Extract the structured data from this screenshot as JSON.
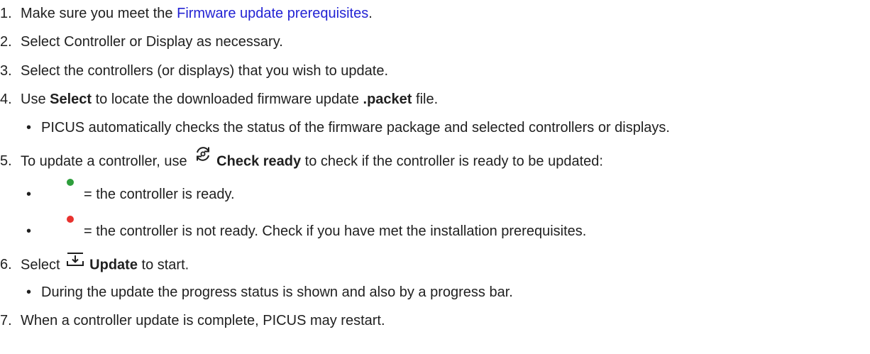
{
  "steps": [
    {
      "num": "1.",
      "pre": "Make sure you meet the ",
      "link": "Firmware update prerequisites",
      "post": "."
    },
    {
      "num": "2.",
      "text": "Select Controller or Display as necessary."
    },
    {
      "num": "3.",
      "text": "Select the controllers (or displays) that you wish to update."
    },
    {
      "num": "4.",
      "pre": "Use ",
      "bold1": "Select",
      "mid": " to locate the downloaded firmware update ",
      "bold2": ".packet",
      "post": " file."
    },
    {
      "num": "5.",
      "pre": "To update a controller, use ",
      "icon": "refresh-icon",
      "bold": "Check ready",
      "post": " to check if the controller is ready to be updated:"
    },
    {
      "num": "6.",
      "pre": "Select ",
      "icon": "download-icon",
      "bold": "Update",
      "post": " to start."
    },
    {
      "num": "7.",
      "text": "When a controller update is complete, PICUS may restart."
    }
  ],
  "bullets": {
    "b4": "PICUS automatically checks the status of the firmware package and selected controllers or displays.",
    "b5_ready": "= the controller is ready.",
    "b5_not_ready": "= the controller is not ready. Check if you have met the installation prerequisites.",
    "b6": "During the update the progress status is shown and also by a progress bar."
  },
  "bullet_symbol": "•",
  "colors": {
    "link": "#2323d4",
    "text": "#1f1f1f",
    "ready_dot": "#2e9e3c",
    "not_ready_dot": "#e8322e"
  }
}
